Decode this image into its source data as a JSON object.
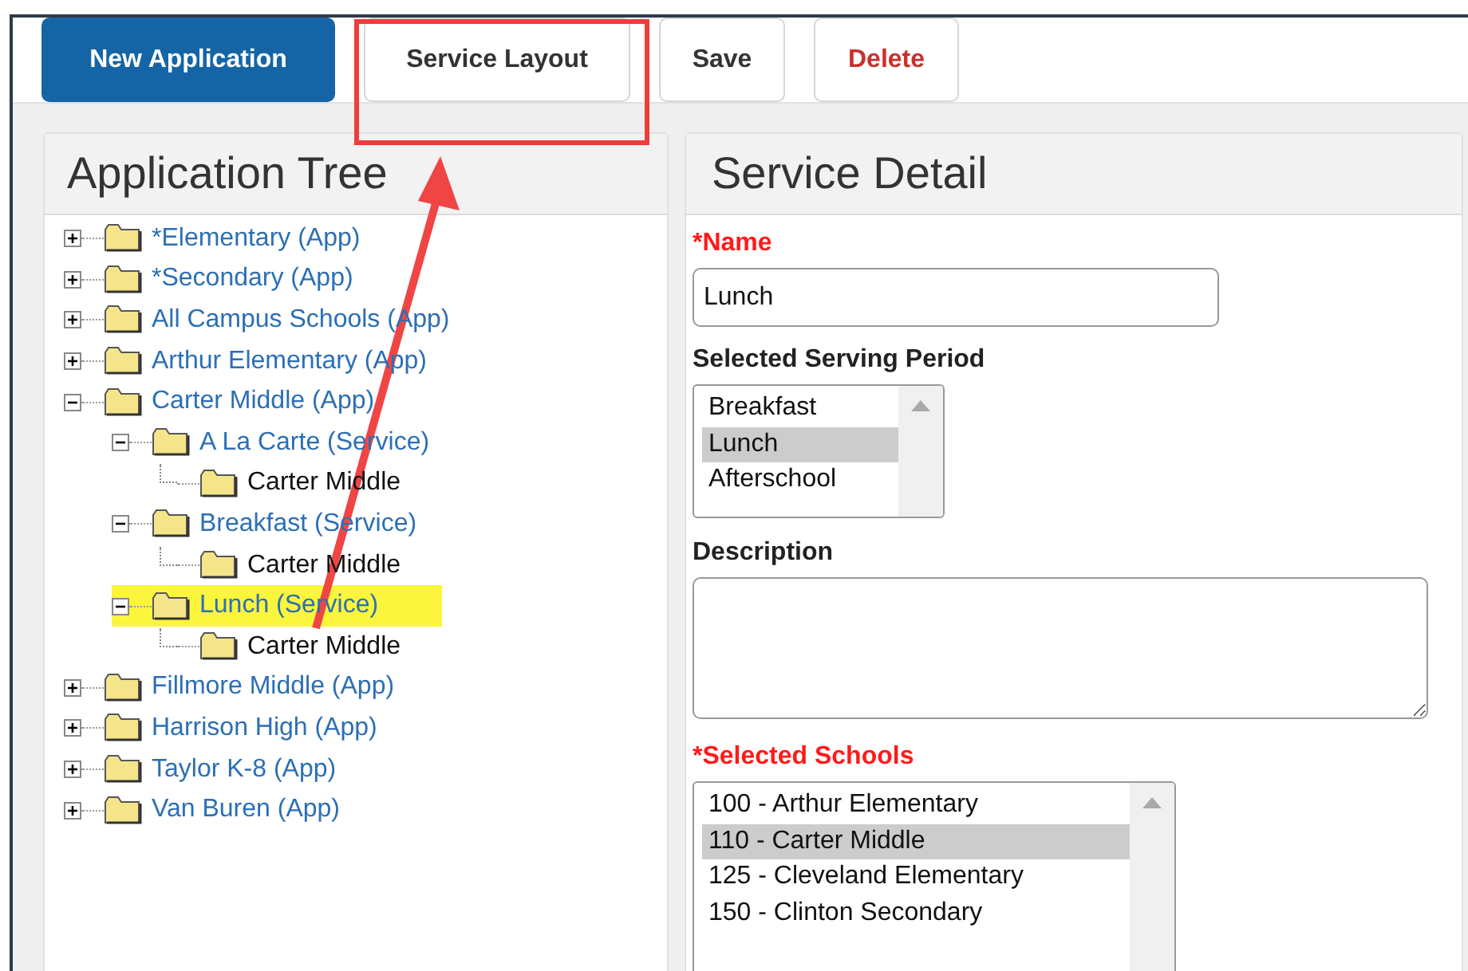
{
  "toolbar": {
    "buttons": [
      {
        "label": "New Application",
        "kind": "primary"
      },
      {
        "label": "Service Layout",
        "kind": "default"
      },
      {
        "label": "Save",
        "kind": "default"
      },
      {
        "label": "Delete",
        "kind": "danger"
      }
    ]
  },
  "tree_panel": {
    "title": "Application Tree",
    "items": [
      {
        "label": "*Elementary (App)",
        "kind": "app",
        "expanded": false,
        "selected": false
      },
      {
        "label": "*Secondary (App)",
        "kind": "app",
        "expanded": false,
        "selected": false
      },
      {
        "label": "All Campus Schools (App)",
        "kind": "app",
        "expanded": false,
        "selected": false
      },
      {
        "label": "Arthur Elementary (App)",
        "kind": "app",
        "expanded": false,
        "selected": false
      },
      {
        "label": "Carter Middle (App)",
        "kind": "app",
        "expanded": true,
        "selected": false,
        "children": [
          {
            "label": "A La Carte (Service)",
            "kind": "service",
            "expanded": true,
            "selected": false,
            "children": [
              {
                "label": "Carter Middle",
                "kind": "school",
                "selected": false
              }
            ]
          },
          {
            "label": "Breakfast (Service)",
            "kind": "service",
            "expanded": true,
            "selected": false,
            "children": [
              {
                "label": "Carter Middle",
                "kind": "school",
                "selected": false
              }
            ]
          },
          {
            "label": "Lunch (Service)",
            "kind": "service",
            "expanded": true,
            "selected": true,
            "children": [
              {
                "label": "Carter Middle",
                "kind": "school",
                "selected": false
              }
            ]
          }
        ]
      },
      {
        "label": "Fillmore Middle (App)",
        "kind": "app",
        "expanded": false,
        "selected": false
      },
      {
        "label": "Harrison High (App)",
        "kind": "app",
        "expanded": false,
        "selected": false
      },
      {
        "label": "Taylor K-8 (App)",
        "kind": "app",
        "expanded": false,
        "selected": false
      },
      {
        "label": "Van Buren (App)",
        "kind": "app",
        "expanded": false,
        "selected": false
      }
    ]
  },
  "detail_panel": {
    "title": "Service Detail",
    "name_field": {
      "label": "*Name",
      "value": "Lunch"
    },
    "serving_period": {
      "label": "Selected Serving Period",
      "options": [
        {
          "label": "Breakfast",
          "selected": false
        },
        {
          "label": "Lunch",
          "selected": true
        },
        {
          "label": "Afterschool",
          "selected": false
        }
      ]
    },
    "description": {
      "label": "Description"
    },
    "schools": {
      "label": "*Selected Schools",
      "options": [
        {
          "label": "100 - Arthur Elementary",
          "selected": false
        },
        {
          "label": "110 - Carter Middle",
          "selected": true
        },
        {
          "label": "125 - Cleveland Elementary",
          "selected": false
        },
        {
          "label": "150 - Clinton Secondary",
          "selected": false
        }
      ]
    }
  }
}
